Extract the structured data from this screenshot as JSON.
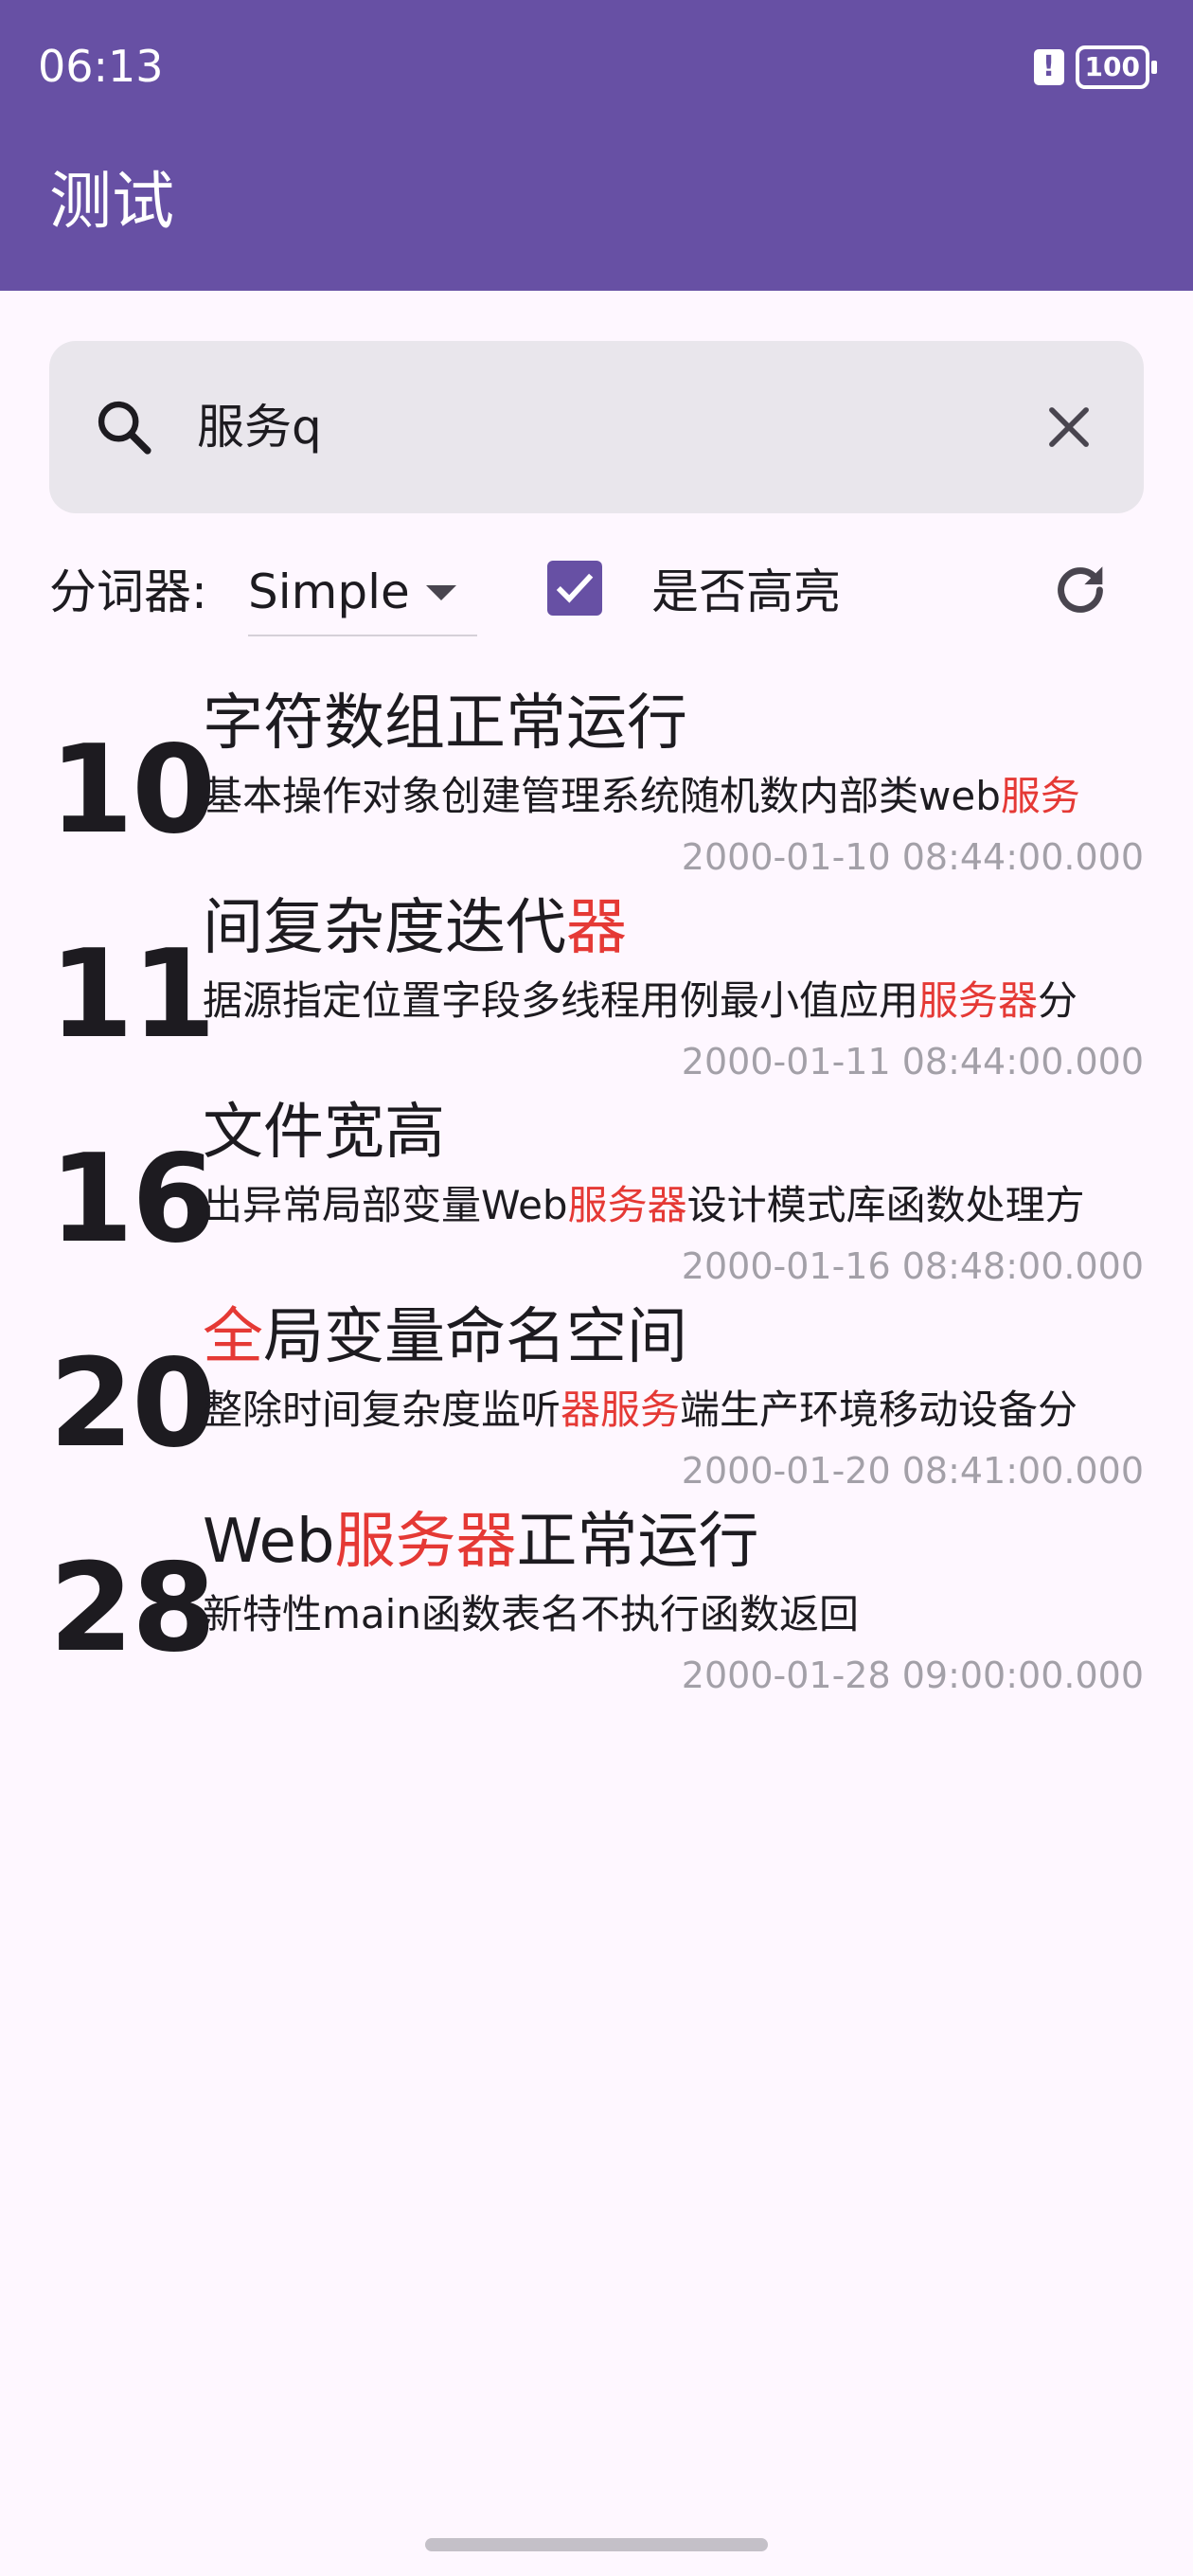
{
  "status_bar": {
    "time": "06:13",
    "battery": "100"
  },
  "app_bar": {
    "title": "测试"
  },
  "search": {
    "value": "服务q"
  },
  "controls": {
    "segmenter_label": "分词器:",
    "segmenter_value": "Simple",
    "highlight_label": "是否高亮",
    "highlight_checked": true
  },
  "colors": {
    "primary": "#6750a4",
    "highlight": "#e53935",
    "background": "#fef7ff"
  },
  "results": [
    {
      "number": "10",
      "title": [
        {
          "t": "字符数组正常运行",
          "h": false
        }
      ],
      "desc": [
        {
          "t": "基本操作对象创建管理系统随机数内部类web",
          "h": false
        },
        {
          "t": "服务",
          "h": true
        }
      ],
      "date": "2000-01-10 08:44:00.000"
    },
    {
      "number": "11",
      "title": [
        {
          "t": "间复杂度迭代",
          "h": false
        },
        {
          "t": "器",
          "h": true
        }
      ],
      "desc": [
        {
          "t": "据源指定位置字段多线程用例最小值应用",
          "h": false
        },
        {
          "t": "服务器",
          "h": true
        },
        {
          "t": "分",
          "h": false
        }
      ],
      "date": "2000-01-11 08:44:00.000"
    },
    {
      "number": "16",
      "title": [
        {
          "t": "文件宽高",
          "h": false
        }
      ],
      "desc": [
        {
          "t": "出异常局部变量Web",
          "h": false
        },
        {
          "t": "服务器",
          "h": true
        },
        {
          "t": "设计模式库函数处理方",
          "h": false
        }
      ],
      "date": "2000-01-16 08:48:00.000"
    },
    {
      "number": "20",
      "title": [
        {
          "t": "全",
          "h": true
        },
        {
          "t": "局变量命名空间",
          "h": false
        }
      ],
      "desc": [
        {
          "t": "整除时间复杂度监听",
          "h": false
        },
        {
          "t": "器服务",
          "h": true
        },
        {
          "t": "端生产环境移动设备分",
          "h": false
        }
      ],
      "date": "2000-01-20 08:41:00.000"
    },
    {
      "number": "28",
      "title": [
        {
          "t": "Web",
          "h": false
        },
        {
          "t": "服务器",
          "h": true
        },
        {
          "t": "正常运行",
          "h": false
        }
      ],
      "desc": [
        {
          "t": "新特性main函数表名不执行函数返回",
          "h": false
        }
      ],
      "date": "2000-01-28 09:00:00.000"
    }
  ]
}
